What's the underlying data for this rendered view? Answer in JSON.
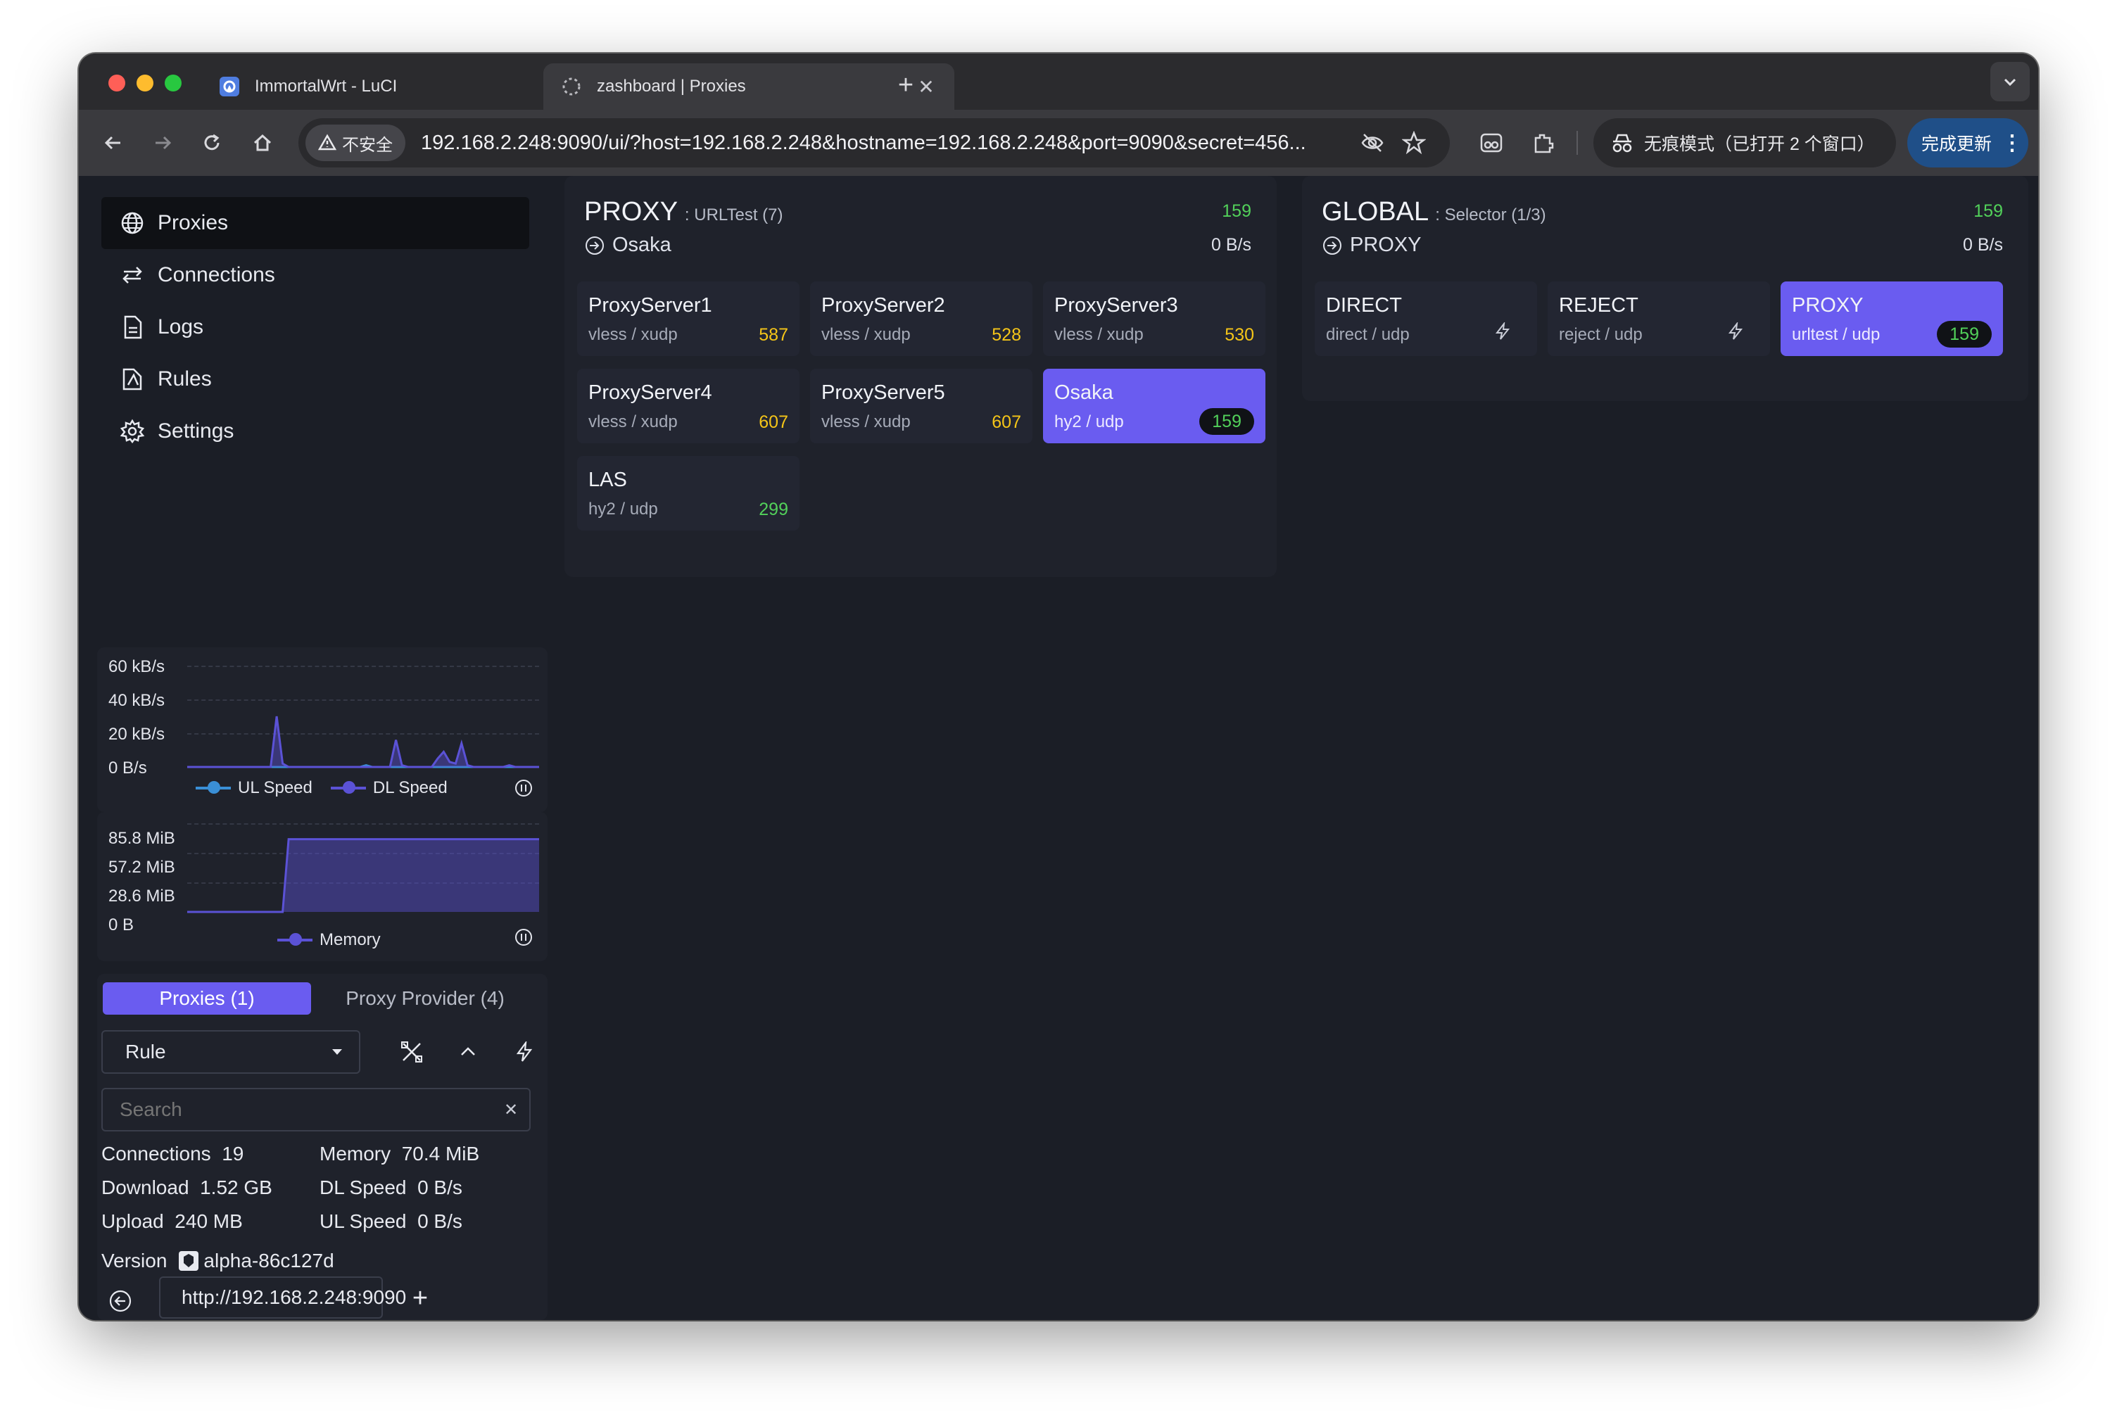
{
  "browser": {
    "tabs": [
      {
        "title": "ImmortalWrt - LuCI",
        "icon": "immortalwrt-icon"
      },
      {
        "title": "zashboard | Proxies",
        "icon": "loading-icon"
      }
    ],
    "security_label": "不安全",
    "url": "192.168.2.248:9090/ui/?host=192.168.2.248&hostname=192.168.2.248&port=9090&secret=456...",
    "incognito_label": "无痕模式（已打开 2 个窗口）",
    "update_label": "完成更新"
  },
  "sidebar": {
    "nav": [
      {
        "label": "Proxies",
        "icon": "globe-icon",
        "active": true
      },
      {
        "label": "Connections",
        "icon": "arrows-icon",
        "active": false
      },
      {
        "label": "Logs",
        "icon": "document-icon",
        "active": false
      },
      {
        "label": "Rules",
        "icon": "rules-icon",
        "active": false
      },
      {
        "label": "Settings",
        "icon": "gear-icon",
        "active": false
      }
    ],
    "speed_chart": {
      "type": "area",
      "ticks": [
        "60 kB/s",
        "40 kB/s",
        "20 kB/s",
        "0 B/s"
      ],
      "ylim": [
        0,
        60
      ],
      "unit": "kB/s",
      "series": [
        {
          "name": "UL Speed",
          "color": "#3a8fd6",
          "values": [
            0,
            0,
            0,
            0,
            0,
            0,
            0,
            0,
            0,
            0,
            0,
            0,
            0,
            0,
            0,
            0,
            0,
            0,
            0,
            0,
            0,
            0,
            0,
            0,
            0,
            0,
            0,
            0,
            0,
            0,
            1,
            0,
            0,
            0,
            0,
            0,
            0,
            0,
            0,
            0,
            0,
            0,
            0,
            0,
            0,
            0,
            0,
            0,
            0,
            0,
            0,
            0,
            0,
            0,
            0,
            0,
            0,
            0,
            0,
            0
          ]
        },
        {
          "name": "DL Speed",
          "color": "#5b52d6",
          "values": [
            0,
            0,
            0,
            0,
            0,
            0,
            0,
            0,
            0,
            0,
            0,
            0,
            0,
            0,
            0,
            30,
            2,
            0,
            0,
            0,
            0,
            0,
            0,
            0,
            0,
            0,
            0,
            0,
            0,
            0,
            0,
            0,
            0,
            0,
            0,
            16,
            1,
            0,
            0,
            0,
            0,
            0,
            5,
            9,
            3,
            2,
            14,
            1,
            0,
            0,
            0,
            0,
            0,
            0,
            1,
            0,
            0,
            0,
            0,
            0
          ]
        }
      ]
    },
    "memory_chart": {
      "type": "area",
      "ticks": [
        "85.8 MiB",
        "57.2 MiB",
        "28.6 MiB",
        "0 B"
      ],
      "ylim": [
        0,
        85.8
      ],
      "unit": "MiB",
      "series": [
        {
          "name": "Memory",
          "color": "#5b52d6",
          "values": [
            0,
            0,
            0,
            0,
            0,
            0,
            0,
            0,
            0,
            0,
            0,
            0,
            0,
            0,
            0,
            0,
            0,
            70.4,
            70.4,
            70.4,
            70.4,
            70.4,
            70.4,
            70.4,
            70.4,
            70.4,
            70.4,
            70.4,
            70.4,
            70.4,
            70.4,
            70.4,
            70.4,
            70.4,
            70.4,
            70.4,
            70.4,
            70.4,
            70.4,
            70.4,
            70.4,
            70.4,
            70.4,
            70.4,
            70.4,
            70.4,
            70.4,
            70.4,
            70.4,
            70.4,
            70.4,
            70.4,
            70.4,
            70.4,
            70.4,
            70.4,
            70.4,
            70.4,
            70.4,
            70.4
          ]
        }
      ]
    },
    "tabs": {
      "proxies": "Proxies (1)",
      "provider": "Proxy Provider (4)"
    },
    "mode_select": "Rule",
    "search_placeholder": "Search",
    "stats": {
      "connections_label": "Connections",
      "connections_value": "19",
      "memory_label": "Memory",
      "memory_value": "70.4 MiB",
      "download_label": "Download",
      "download_value": "1.52 GB",
      "dl_speed_label": "DL Speed",
      "dl_speed_value": "0 B/s",
      "upload_label": "Upload",
      "upload_value": "240 MB",
      "ul_speed_label": "UL Speed",
      "ul_speed_value": "0 B/s",
      "version_label": "Version",
      "version_value": "alpha-86c127d"
    },
    "backend_url": "http://192.168.2.248:9090"
  },
  "groups": [
    {
      "name": "PROXY",
      "subtitle": ": URLTest (7)",
      "latency": "159",
      "current": "Osaka",
      "speed": "0 B/s",
      "nodes": [
        {
          "name": "ProxyServer1",
          "type": "vless / xudp",
          "latency": "587",
          "latency_color": "#f5c518",
          "selected": false
        },
        {
          "name": "ProxyServer2",
          "type": "vless / xudp",
          "latency": "528",
          "latency_color": "#f5c518",
          "selected": false
        },
        {
          "name": "ProxyServer3",
          "type": "vless / xudp",
          "latency": "530",
          "latency_color": "#f5c518",
          "selected": false
        },
        {
          "name": "ProxyServer4",
          "type": "vless / xudp",
          "latency": "607",
          "latency_color": "#f5c518",
          "selected": false
        },
        {
          "name": "ProxyServer5",
          "type": "vless / xudp",
          "latency": "607",
          "latency_color": "#f5c518",
          "selected": false
        },
        {
          "name": "Osaka",
          "type": "hy2 / udp",
          "latency": "159",
          "latency_color": "#52d15a",
          "selected": true
        },
        {
          "name": "LAS",
          "type": "hy2 / udp",
          "latency": "299",
          "latency_color": "#52d15a",
          "selected": false
        }
      ]
    },
    {
      "name": "GLOBAL",
      "subtitle": ": Selector (1/3)",
      "latency": "159",
      "current": "PROXY",
      "speed": "0 B/s",
      "nodes": [
        {
          "name": "DIRECT",
          "type": "direct / udp",
          "latency": "",
          "latency_color": "",
          "selected": false
        },
        {
          "name": "REJECT",
          "type": "reject / udp",
          "latency": "",
          "latency_color": "",
          "selected": false
        },
        {
          "name": "PROXY",
          "type": "urltest / udp",
          "latency": "159",
          "latency_color": "#52d15a",
          "selected": true
        }
      ]
    }
  ]
}
